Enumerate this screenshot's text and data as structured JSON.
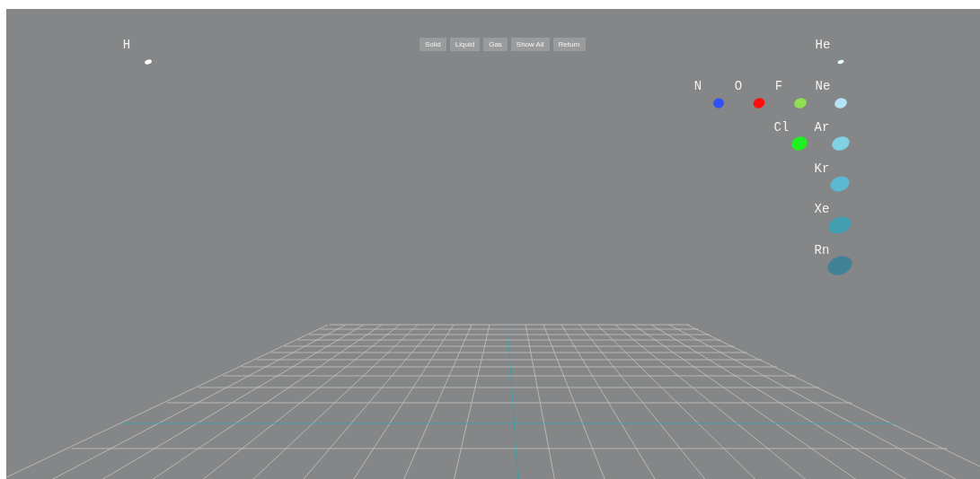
{
  "toolbar": {
    "buttons": [
      "Solid",
      "Liquid",
      "Gas",
      "Show All",
      "Return"
    ]
  },
  "elements": [
    {
      "symbol": "H",
      "color": "#ffffff"
    },
    {
      "symbol": "He",
      "color": "#e8ffff"
    },
    {
      "symbol": "N",
      "color": "#3050f8"
    },
    {
      "symbol": "O",
      "color": "#ff0d0d"
    },
    {
      "symbol": "F",
      "color": "#90e050"
    },
    {
      "symbol": "Ne",
      "color": "#b3e3f5"
    },
    {
      "symbol": "Cl",
      "color": "#1ff01f"
    },
    {
      "symbol": "Ar",
      "color": "#80d1e3"
    },
    {
      "symbol": "Kr",
      "color": "#5cb8d1"
    },
    {
      "symbol": "Xe",
      "color": "#429eb0"
    },
    {
      "symbol": "Rn",
      "color": "#428296"
    }
  ]
}
